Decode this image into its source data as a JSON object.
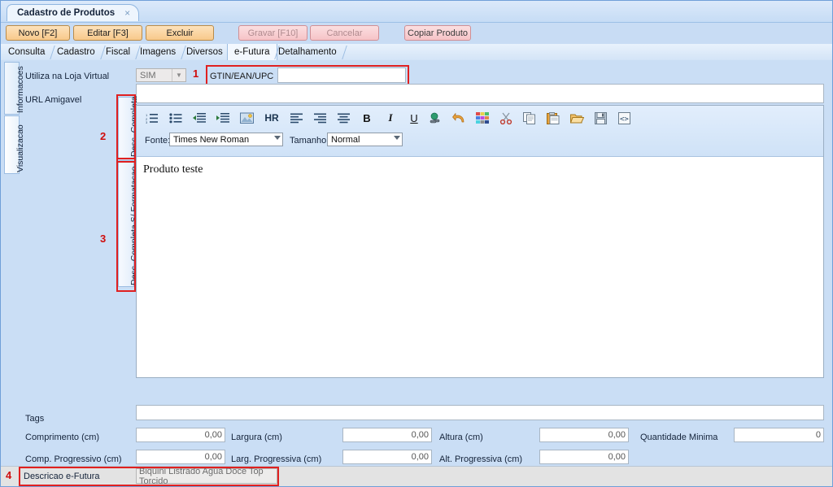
{
  "window": {
    "doc_tab_title": "Cadastro de Produtos",
    "close_glyph": "×"
  },
  "toolbar": {
    "buttons": [
      {
        "label": "Novo [F2]",
        "style": "orange",
        "disabled": false
      },
      {
        "label": "Editar [F3]",
        "style": "orange",
        "disabled": false
      },
      {
        "label": "Excluir",
        "style": "orange",
        "disabled": false
      },
      {
        "label": "Gravar [F10]",
        "style": "red",
        "disabled": true
      },
      {
        "label": "Cancelar",
        "style": "red",
        "disabled": true
      },
      {
        "label": "Copiar Produto",
        "style": "red",
        "disabled": false
      }
    ]
  },
  "tabs": {
    "items": [
      {
        "label": "Consulta",
        "active": false
      },
      {
        "label": "Cadastro",
        "active": false
      },
      {
        "label": "Fiscal",
        "active": false
      },
      {
        "label": "Imagens",
        "active": false
      },
      {
        "label": "Diversos",
        "active": false
      },
      {
        "label": "e-Futura",
        "active": true
      },
      {
        "label": "Detalhamento",
        "active": false
      }
    ]
  },
  "side_tabs": {
    "items": [
      {
        "label": "Informacoes",
        "selected": false
      },
      {
        "label": "Visualizacao",
        "selected": true
      }
    ]
  },
  "form": {
    "loja_virtual_label": "Utiliza na Loja Virtual",
    "loja_virtual_value": "SIM",
    "gtin_label": "GTIN/EAN/UPC",
    "gtin_value": "",
    "url_label": "URL Amigavel",
    "url_value": "",
    "tags_label": "Tags",
    "tags_value": ""
  },
  "editor_tabs": {
    "items": [
      {
        "label": "Desc. Completa",
        "selected": true
      },
      {
        "label": "Desc. Completa S/ Formatacao",
        "selected": false
      }
    ]
  },
  "editor": {
    "icons": [
      {
        "name": "ordered-list-icon",
        "glyph": "ol"
      },
      {
        "name": "unordered-list-icon",
        "glyph": "ul"
      },
      {
        "name": "outdent-icon",
        "glyph": "outdent"
      },
      {
        "name": "indent-icon",
        "glyph": "indent"
      },
      {
        "name": "insert-image-icon",
        "glyph": "image"
      },
      {
        "name": "horizontal-rule-icon",
        "glyph": "HR"
      },
      {
        "name": "align-left-icon",
        "glyph": "alignleft"
      },
      {
        "name": "align-right-icon",
        "glyph": "alignright"
      },
      {
        "name": "align-center-icon",
        "glyph": "aligncenter"
      },
      {
        "name": "bold-icon",
        "glyph": "B"
      },
      {
        "name": "italic-icon",
        "glyph": "I"
      },
      {
        "name": "underline-icon",
        "glyph": "U"
      },
      {
        "name": "insert-link-icon",
        "glyph": "link"
      },
      {
        "name": "undo-icon",
        "glyph": "undo"
      },
      {
        "name": "text-color-icon",
        "glyph": "palette"
      },
      {
        "name": "cut-icon",
        "glyph": "scissors"
      },
      {
        "name": "copy-icon",
        "glyph": "copy"
      },
      {
        "name": "paste-icon",
        "glyph": "paste"
      },
      {
        "name": "open-file-icon",
        "glyph": "folder"
      },
      {
        "name": "save-icon",
        "glyph": "floppy"
      },
      {
        "name": "html-source-icon",
        "glyph": "code"
      }
    ],
    "font_label": "Fonte:",
    "font_value": "Times New Roman",
    "size_label": "Tamanho:",
    "size_value": "Normal",
    "content": "Produto teste"
  },
  "measures": {
    "rows": [
      [
        {
          "label": "Comprimento (cm)",
          "value": "0,00"
        },
        {
          "label": "Largura (cm)",
          "value": "0,00"
        },
        {
          "label": "Altura (cm)",
          "value": "0,00"
        },
        {
          "label": "Quantidade Minima",
          "value": "0"
        }
      ],
      [
        {
          "label": "Comp. Progressivo (cm)",
          "value": "0,00"
        },
        {
          "label": "Larg. Progressiva (cm)",
          "value": "0,00"
        },
        {
          "label": "Alt. Progressiva (cm)",
          "value": "0,00"
        }
      ]
    ]
  },
  "footer": {
    "desc_label": "Descricao e-Futura",
    "desc_value": "Biquini Listrado Agua Doce Top Torcido"
  },
  "annotations": {
    "markers": [
      {
        "number": "1"
      },
      {
        "number": "2"
      },
      {
        "number": "3"
      },
      {
        "number": "4"
      }
    ],
    "color": "#e02020"
  }
}
